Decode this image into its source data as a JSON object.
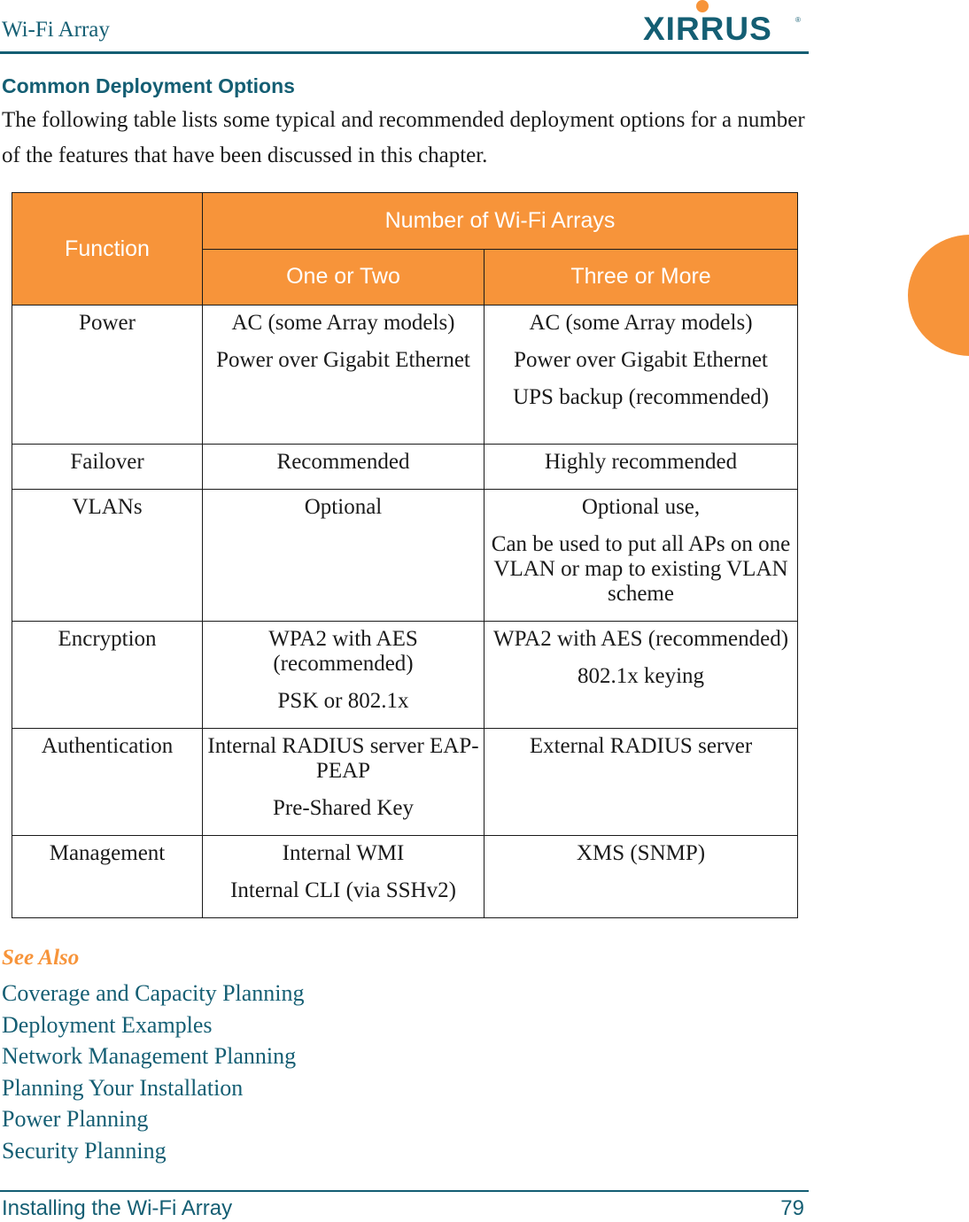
{
  "header": {
    "title": "Wi-Fi Array",
    "logo_text": "XIRRUS",
    "logo_reg": "®"
  },
  "section": {
    "title": "Common Deployment Options",
    "intro": "The following table lists some typical and recommended deployment options for a number of the features that have been discussed in this chapter."
  },
  "table": {
    "headers": {
      "function": "Function",
      "group": "Number of Wi-Fi Arrays",
      "col1": "One or Two",
      "col2": "Three or More"
    },
    "rows": [
      {
        "function": "Power",
        "one_or_two": [
          "AC (some Array models)",
          "Power over Gigabit Ethernet"
        ],
        "three_or_more": [
          "AC (some Array models)",
          "Power over Gigabit Ethernet",
          "UPS backup (recommended)"
        ]
      },
      {
        "function": "Failover",
        "one_or_two": [
          "Recommended"
        ],
        "three_or_more": [
          "Highly recommended"
        ]
      },
      {
        "function": "VLANs",
        "one_or_two": [
          "Optional"
        ],
        "three_or_more": [
          "Optional use,",
          "Can be used to put all APs on one VLAN or map to existing VLAN scheme"
        ]
      },
      {
        "function": "Encryption",
        "one_or_two": [
          "WPA2 with AES (recommended)",
          "PSK or 802.1x"
        ],
        "three_or_more": [
          "WPA2 with AES (recommended)",
          "802.1x keying"
        ]
      },
      {
        "function": "Authentication",
        "one_or_two": [
          "Internal RADIUS server EAP-PEAP",
          "Pre-Shared Key"
        ],
        "three_or_more": [
          "External RADIUS server"
        ]
      },
      {
        "function": "Management",
        "one_or_two": [
          "Internal WMI",
          "Internal CLI (via SSHv2)"
        ],
        "three_or_more": [
          "XMS (SNMP)"
        ]
      }
    ]
  },
  "see_also": {
    "title": "See Also",
    "links": [
      "Coverage and Capacity Planning",
      "Deployment Examples",
      "Network Management Planning",
      "Planning Your Installation",
      "Power Planning",
      "Security Planning"
    ]
  },
  "footer": {
    "chapter": "Installing the Wi-Fi Array",
    "page_number": "79"
  },
  "colors": {
    "brand_teal": "#145e73",
    "accent_orange": "#f7943a"
  }
}
